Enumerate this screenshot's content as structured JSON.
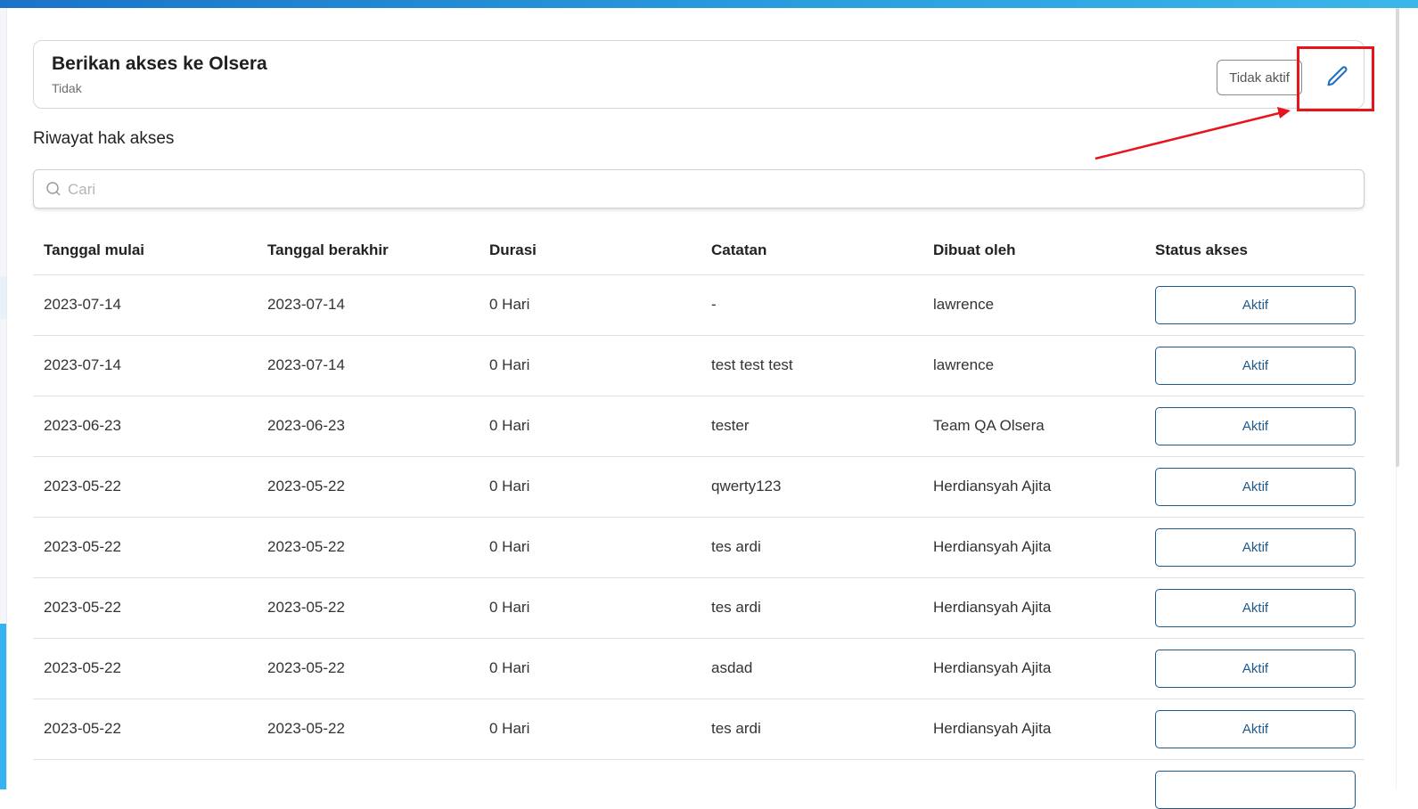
{
  "colors": {
    "brand_bar": "#1a73c8",
    "annotation": "#e8141b",
    "button_border": "#1f5a8a"
  },
  "access": {
    "title": "Berikan akses ke Olsera",
    "subtitle": "Tidak",
    "status_label": "Tidak aktif",
    "edit_icon": "pencil-icon"
  },
  "history": {
    "title": "Riwayat hak akses",
    "search_placeholder": "Cari",
    "search_icon": "search-icon",
    "columns": [
      "Tanggal mulai",
      "Tanggal berakhir",
      "Durasi",
      "Catatan",
      "Dibuat oleh",
      "Status akses"
    ],
    "rows": [
      {
        "start": "2023-07-14",
        "end": "2023-07-14",
        "duration": "0 Hari",
        "note": "-",
        "created_by": "lawrence",
        "status": "Aktif"
      },
      {
        "start": "2023-07-14",
        "end": "2023-07-14",
        "duration": "0 Hari",
        "note": "test test test",
        "created_by": "lawrence",
        "status": "Aktif"
      },
      {
        "start": "2023-06-23",
        "end": "2023-06-23",
        "duration": "0 Hari",
        "note": "tester",
        "created_by": "Team QA Olsera",
        "status": "Aktif"
      },
      {
        "start": "2023-05-22",
        "end": "2023-05-22",
        "duration": "0 Hari",
        "note": "qwerty123",
        "created_by": "Herdiansyah Ajita",
        "status": "Aktif"
      },
      {
        "start": "2023-05-22",
        "end": "2023-05-22",
        "duration": "0 Hari",
        "note": "tes ardi",
        "created_by": "Herdiansyah Ajita",
        "status": "Aktif"
      },
      {
        "start": "2023-05-22",
        "end": "2023-05-22",
        "duration": "0 Hari",
        "note": "tes ardi",
        "created_by": "Herdiansyah Ajita",
        "status": "Aktif"
      },
      {
        "start": "2023-05-22",
        "end": "2023-05-22",
        "duration": "0 Hari",
        "note": "asdad",
        "created_by": "Herdiansyah Ajita",
        "status": "Aktif"
      },
      {
        "start": "2023-05-22",
        "end": "2023-05-22",
        "duration": "0 Hari",
        "note": "tes ardi",
        "created_by": "Herdiansyah Ajita",
        "status": "Aktif"
      }
    ]
  }
}
